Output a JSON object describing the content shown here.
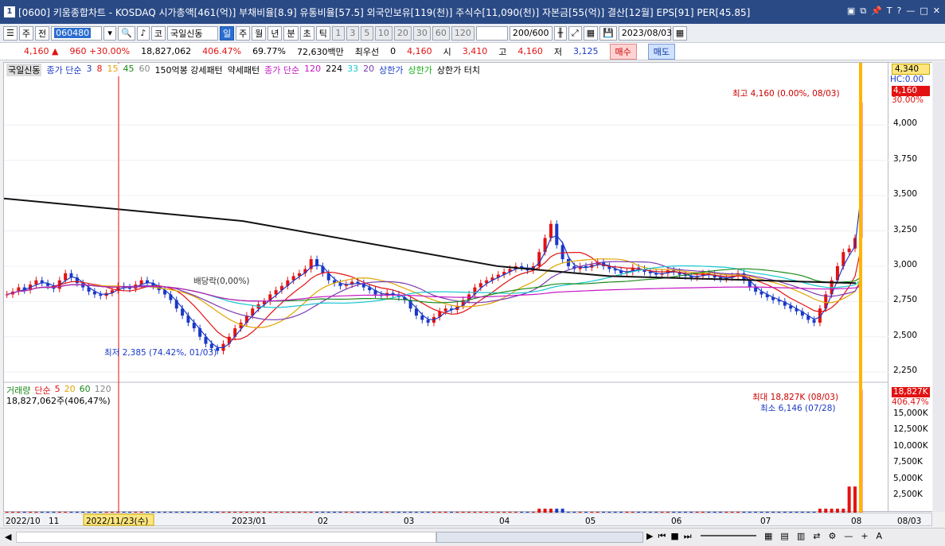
{
  "title": {
    "window_num": "1",
    "text": "[0600] 키움종합차트 - KOSDAQ 시가총액[461(억)] 부채비율[8.9] 유통비율[57.5] 외국인보유[119(천)] 주식수[11,090(천)] 자본금[55(억)] 결산[12월] EPS[91] PER[45.85]"
  },
  "toolbar": {
    "mode": "주",
    "prev": "전",
    "code": "060480",
    "name": "국일신동",
    "market_btn": "코",
    "periods": [
      "일",
      "주",
      "월",
      "년",
      "분",
      "초",
      "틱"
    ],
    "active_period": "일",
    "numbers": [
      "1",
      "3",
      "5",
      "10",
      "20",
      "30",
      "60",
      "120"
    ],
    "count": "200/600",
    "date": "2023/08/03"
  },
  "quote": {
    "price": "4,160",
    "change": "960 +30.00%",
    "volume": "18,827,062",
    "vol_ratio": "406.47%",
    "turnover": "69.77%",
    "amount": "72,630백만",
    "pref_label": "최우선",
    "pref_value": "0",
    "last": "4,160",
    "open_label": "시",
    "open": "3,410",
    "high_label": "고",
    "high": "4,160",
    "low_label": "저",
    "low": "3,125",
    "buy": "매수",
    "sell": "매도"
  },
  "legend": {
    "name": "국일신동",
    "ma_label": "종가 단순",
    "ma": [
      "3",
      "8",
      "15",
      "45",
      "60"
    ],
    "pattern1": "150억봉 강세패턴",
    "pattern2": "약세패턴",
    "ma2_label": "종가 단순",
    "ma2": [
      "120",
      "224",
      "33",
      "20"
    ],
    "ceil1": "상한가",
    "ceil2": "상한가",
    "ceil3": "상한가 터치"
  },
  "annotations": {
    "high": "최고 4,160 (0.00%, 08/03)",
    "low": "최저 2,385 (74.42%, 01/03)",
    "dividend": "배당락(0,00%)",
    "vol_max": "최대 18,827K (08/03)",
    "vol_min": "최소 6,146 (07/28)"
  },
  "price_axis": {
    "tag_top": "4,340",
    "hc": "HC:0.00",
    "current": "4,160",
    "current_pct": "30.00%",
    "ticks": [
      "4,000",
      "3,750",
      "3,500",
      "3,250",
      "3,000",
      "2,750",
      "2,500",
      "2,250"
    ]
  },
  "volume_legend": {
    "label": "거래량",
    "ma_label": "단순",
    "ma": [
      "5",
      "20",
      "60",
      "120"
    ],
    "value": "18,827,062주(406,47%)"
  },
  "volume_axis": {
    "current": "18,827K",
    "pct": "406.47%",
    "ticks": [
      "15,000K",
      "12,500K",
      "10,000K",
      "7,500K",
      "5,000K",
      "2,500K"
    ]
  },
  "dates": [
    "2022/10",
    "11",
    "2023/01",
    "02",
    "03",
    "04",
    "05",
    "06",
    "07",
    "08"
  ],
  "date_cursor": "2022/11/23(수)",
  "date_end": "08/03",
  "colors": {
    "up": "#e21212",
    "down": "#1a39c8",
    "title_bg": "#2a4a86"
  },
  "chart_data": {
    "type": "candlestick",
    "price_ylim": [
      2200,
      4340
    ],
    "volume_ylim": [
      0,
      19000
    ],
    "closes": [
      2800,
      2820,
      2850,
      2830,
      2870,
      2900,
      2880,
      2860,
      2840,
      2900,
      2950,
      2920,
      2880,
      2850,
      2820,
      2800,
      2790,
      2810,
      2830,
      2860,
      2850,
      2840,
      2870,
      2900,
      2880,
      2860,
      2830,
      2800,
      2760,
      2700,
      2650,
      2600,
      2560,
      2500,
      2450,
      2420,
      2400,
      2450,
      2500,
      2560,
      2600,
      2650,
      2700,
      2730,
      2750,
      2800,
      2830,
      2860,
      2900,
      2930,
      2950,
      2980,
      3050,
      3000,
      2950,
      2900,
      2880,
      2860,
      2870,
      2890,
      2880,
      2850,
      2830,
      2800,
      2790,
      2810,
      2800,
      2780,
      2760,
      2700,
      2650,
      2620,
      2600,
      2640,
      2680,
      2700,
      2690,
      2720,
      2760,
      2800,
      2850,
      2880,
      2900,
      2920,
      2940,
      2960,
      2980,
      3000,
      2990,
      2970,
      3000,
      3100,
      3200,
      3300,
      3150,
      3050,
      3000,
      2980,
      3000,
      2990,
      3010,
      3030,
      3000,
      2980,
      2970,
      2950,
      2960,
      2990,
      2980,
      2960,
      2950,
      2940,
      2950,
      2970,
      2960,
      2940,
      2930,
      2920,
      2930,
      2950,
      2940,
      2920,
      2910,
      2920,
      2930,
      2950,
      2900,
      2850,
      2820,
      2800,
      2780,
      2760,
      2750,
      2720,
      2700,
      2680,
      2650,
      2620,
      2600,
      2700,
      2800,
      2900,
      3000,
      3100,
      3125,
      3200,
      4160
    ]
  }
}
